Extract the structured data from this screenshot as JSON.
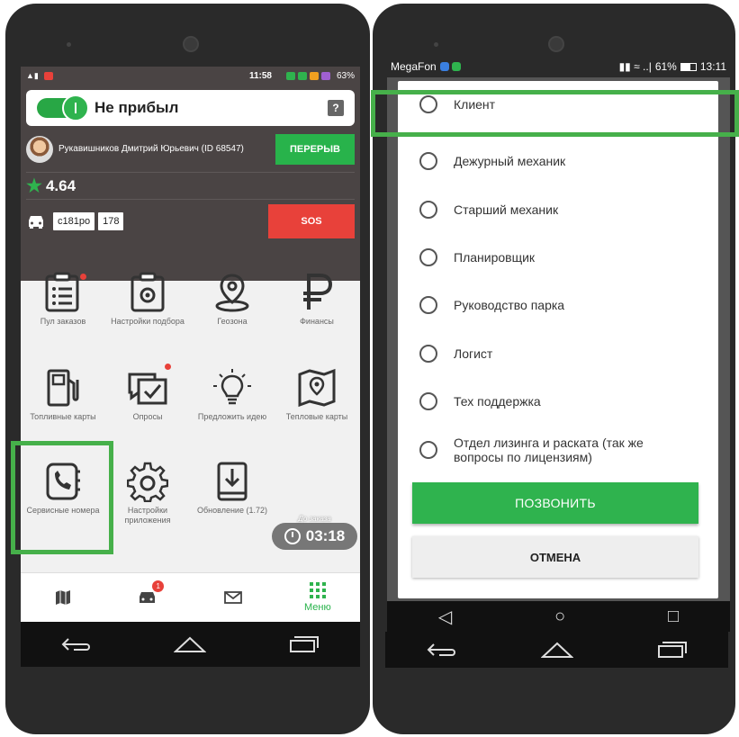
{
  "left": {
    "statusbar": {
      "time": "11:58",
      "battery": "63%"
    },
    "status_toggle_label": "Не прибыл",
    "help_icon": "?",
    "driver_name": "Рукавишников Дмитрий Юрьевич (ID 68547)",
    "break_button": "ПЕРЕРЫВ",
    "rating": "4.64",
    "plate_main": "с181ро",
    "plate_region": "178",
    "sos_button": "SOS",
    "tiles": [
      {
        "label": "Пул заказов",
        "icon": "list-icon"
      },
      {
        "label": "Настройки подбора",
        "icon": "settings-clipboard-icon"
      },
      {
        "label": "Геозона",
        "icon": "map-pin-icon"
      },
      {
        "label": "Финансы",
        "icon": "ruble-icon"
      },
      {
        "label": "Топливные карты",
        "icon": "fuel-pump-icon"
      },
      {
        "label": "Опросы",
        "icon": "poll-icon"
      },
      {
        "label": "Предложить идею",
        "icon": "lightbulb-icon"
      },
      {
        "label": "Тепловые карты",
        "icon": "heat-map-icon"
      },
      {
        "label": "Сервисные номера",
        "icon": "phone-book-icon"
      },
      {
        "label": "Настройки приложения",
        "icon": "gear-icon"
      },
      {
        "label": "Обновление (1.72)",
        "icon": "download-icon"
      }
    ],
    "timer_label": "До заказа",
    "timer_value": "03:18",
    "bottom_nav": {
      "menu_label": "Меню",
      "car_badge": "1"
    }
  },
  "right": {
    "statusbar": {
      "carrier": "MegaFon",
      "battery": "61%",
      "time": "13:11"
    },
    "options": [
      "Клиент",
      "Дежурный механик",
      "Старший механик",
      "Планировщик",
      "Руководство парка",
      "Логист",
      "Тех поддержка",
      "Отдел лизинга и раската (так же вопросы по лицензиям)"
    ],
    "call_button": "ПОЗВОНИТЬ",
    "cancel_button": "ОТМЕНА"
  },
  "colors": {
    "accent_green": "#2fb34e",
    "sos_red": "#e8413a",
    "highlight": "#46b04a"
  }
}
